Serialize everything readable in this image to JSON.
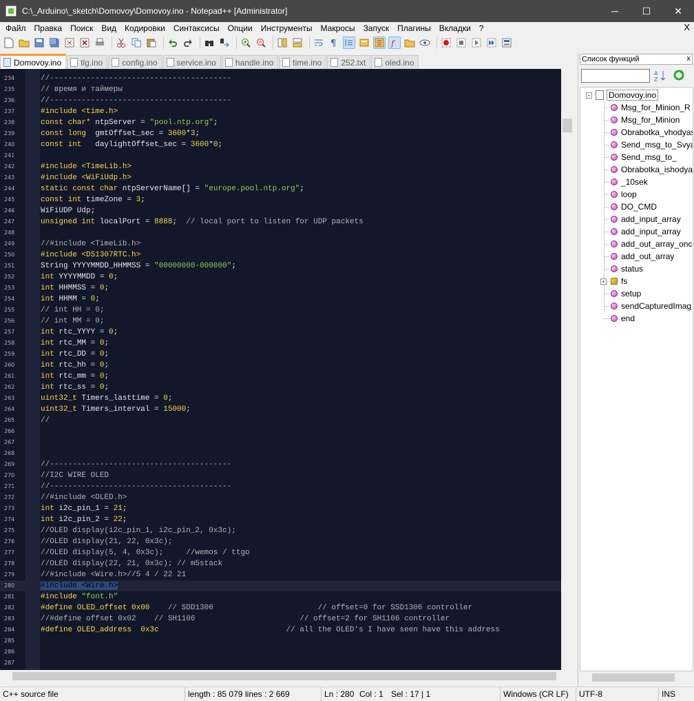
{
  "window": {
    "title": "C:\\_Arduino\\_sketch\\Domovoy\\Domovoy.ino - Notepad++ [Administrator]",
    "minimize": "─",
    "maximize": "☐",
    "close": "✕"
  },
  "menu": {
    "items": [
      "Файл",
      "Правка",
      "Поиск",
      "Вид",
      "Кодировки",
      "Синтаксисы",
      "Опции",
      "Инструменты",
      "Макросы",
      "Запуск",
      "Плагины",
      "Вкладки",
      "?"
    ],
    "close": "X"
  },
  "toolbar": {
    "icons": [
      "new-file",
      "open-file",
      "save",
      "save-all",
      "close-file",
      "close-all",
      "print",
      "cut",
      "copy",
      "paste",
      "undo",
      "redo",
      "find",
      "replace",
      "zoom-in",
      "zoom-out",
      "sync-vertical",
      "sync-horizontal",
      "word-wrap",
      "show-all-chars",
      "indent-guide",
      "doc-map",
      "function-list",
      "folder-workspace",
      "monitor",
      "record-macro",
      "stop-record",
      "play-macro",
      "play-multiple",
      "save-macro"
    ]
  },
  "tabs": [
    {
      "label": "Domovoy.ino",
      "active": true
    },
    {
      "label": "tlg.ino",
      "active": false
    },
    {
      "label": "config.ino",
      "active": false
    },
    {
      "label": "service.ino",
      "active": false
    },
    {
      "label": "handle.ino",
      "active": false
    },
    {
      "label": "time.ino",
      "active": false
    },
    {
      "label": "252.txt",
      "active": false
    },
    {
      "label": "oled.ino",
      "active": false
    }
  ],
  "editor": {
    "lines": [
      {
        "n": "234",
        "segs": [
          [
            "com",
            "//----------------------------------------"
          ]
        ]
      },
      {
        "n": "235",
        "segs": [
          [
            "com",
            "// время и таймеры"
          ]
        ]
      },
      {
        "n": "236",
        "segs": [
          [
            "com",
            "//----------------------------------------"
          ]
        ]
      },
      {
        "n": "237",
        "segs": [
          [
            "pp",
            "#include <time.h>"
          ]
        ]
      },
      {
        "n": "238",
        "segs": [
          [
            "kw",
            "const char*"
          ],
          [
            "txt",
            " ntpServer = "
          ],
          [
            "str",
            "\"pool.ntp.org\""
          ],
          [
            "txt",
            ";"
          ]
        ]
      },
      {
        "n": "239",
        "segs": [
          [
            "kw",
            "const long"
          ],
          [
            "txt",
            "  gmtOffset_sec = "
          ],
          [
            "num",
            "3600"
          ],
          [
            "txt",
            "*"
          ],
          [
            "num",
            "3"
          ],
          [
            "txt",
            ";"
          ]
        ]
      },
      {
        "n": "240",
        "segs": [
          [
            "kw",
            "const int"
          ],
          [
            "txt",
            "   daylightOffset_sec = "
          ],
          [
            "num",
            "3600"
          ],
          [
            "txt",
            "*"
          ],
          [
            "num",
            "0"
          ],
          [
            "txt",
            ";"
          ]
        ]
      },
      {
        "n": "241",
        "segs": []
      },
      {
        "n": "242",
        "segs": [
          [
            "pp",
            "#include <TimeLib.h>"
          ]
        ]
      },
      {
        "n": "243",
        "segs": [
          [
            "pp",
            "#include <WiFiUdp.h>"
          ]
        ]
      },
      {
        "n": "244",
        "segs": [
          [
            "kw",
            "static const char"
          ],
          [
            "txt",
            " ntpServerName[] = "
          ],
          [
            "str",
            "\"europe.pool.ntp.org\""
          ],
          [
            "txt",
            ";"
          ]
        ]
      },
      {
        "n": "245",
        "segs": [
          [
            "kw",
            "const int"
          ],
          [
            "txt",
            " timeZone = "
          ],
          [
            "num",
            "3"
          ],
          [
            "txt",
            ";"
          ]
        ]
      },
      {
        "n": "246",
        "segs": [
          [
            "txt",
            "WiFiUDP Udp;"
          ]
        ]
      },
      {
        "n": "247",
        "segs": [
          [
            "kw",
            "unsigned int"
          ],
          [
            "txt",
            " localPort = "
          ],
          [
            "num",
            "8888"
          ],
          [
            "txt",
            ";  "
          ],
          [
            "com",
            "// local port to listen for UDP packets"
          ]
        ]
      },
      {
        "n": "248",
        "segs": []
      },
      {
        "n": "249",
        "segs": [
          [
            "com",
            "//#include <TimeLib.h>"
          ]
        ]
      },
      {
        "n": "250",
        "segs": [
          [
            "pp",
            "#include <DS1307RTC.h>"
          ]
        ]
      },
      {
        "n": "251",
        "segs": [
          [
            "txt",
            "String YYYYMMDD_HHMMSS = "
          ],
          [
            "str",
            "\"00000000-000000\""
          ],
          [
            "txt",
            ";"
          ]
        ]
      },
      {
        "n": "252",
        "segs": [
          [
            "kw",
            "int"
          ],
          [
            "txt",
            " YYYYMMDD = "
          ],
          [
            "num",
            "0"
          ],
          [
            "txt",
            ";"
          ]
        ]
      },
      {
        "n": "253",
        "segs": [
          [
            "kw",
            "int"
          ],
          [
            "txt",
            " HHMMSS = "
          ],
          [
            "num",
            "0"
          ],
          [
            "txt",
            ";"
          ]
        ]
      },
      {
        "n": "254",
        "segs": [
          [
            "kw",
            "int"
          ],
          [
            "txt",
            " HHMM = "
          ],
          [
            "num",
            "0"
          ],
          [
            "txt",
            ";"
          ]
        ]
      },
      {
        "n": "255",
        "segs": [
          [
            "com",
            "// int HH = 0;"
          ]
        ]
      },
      {
        "n": "256",
        "segs": [
          [
            "com",
            "// int MM = 0;"
          ]
        ]
      },
      {
        "n": "257",
        "segs": [
          [
            "kw",
            "int"
          ],
          [
            "txt",
            " rtc_YYYY = "
          ],
          [
            "num",
            "0"
          ],
          [
            "txt",
            ";"
          ]
        ]
      },
      {
        "n": "258",
        "segs": [
          [
            "kw",
            "int"
          ],
          [
            "txt",
            " rtc_MM = "
          ],
          [
            "num",
            "0"
          ],
          [
            "txt",
            ";"
          ]
        ]
      },
      {
        "n": "259",
        "segs": [
          [
            "kw",
            "int"
          ],
          [
            "txt",
            " rtc_DD = "
          ],
          [
            "num",
            "0"
          ],
          [
            "txt",
            ";"
          ]
        ]
      },
      {
        "n": "260",
        "segs": [
          [
            "kw",
            "int"
          ],
          [
            "txt",
            " rtc_hh = "
          ],
          [
            "num",
            "0"
          ],
          [
            "txt",
            ";"
          ]
        ]
      },
      {
        "n": "261",
        "segs": [
          [
            "kw",
            "int"
          ],
          [
            "txt",
            " rtc_mm = "
          ],
          [
            "num",
            "0"
          ],
          [
            "txt",
            ";"
          ]
        ]
      },
      {
        "n": "262",
        "segs": [
          [
            "kw",
            "int"
          ],
          [
            "txt",
            " rtc_ss = "
          ],
          [
            "num",
            "0"
          ],
          [
            "txt",
            ";"
          ]
        ]
      },
      {
        "n": "263",
        "segs": [
          [
            "kw",
            "uint32_t"
          ],
          [
            "txt",
            " Timers_lasttime = "
          ],
          [
            "num",
            "0"
          ],
          [
            "txt",
            ";"
          ]
        ]
      },
      {
        "n": "264",
        "segs": [
          [
            "kw",
            "uint32_t"
          ],
          [
            "txt",
            " Timers_interval = "
          ],
          [
            "num",
            "15000"
          ],
          [
            "txt",
            ";"
          ]
        ]
      },
      {
        "n": "265",
        "segs": [
          [
            "com",
            "//"
          ]
        ]
      },
      {
        "n": "266",
        "segs": []
      },
      {
        "n": "267",
        "segs": []
      },
      {
        "n": "268",
        "segs": []
      },
      {
        "n": "269",
        "segs": [
          [
            "com",
            "//----------------------------------------"
          ]
        ]
      },
      {
        "n": "270",
        "segs": [
          [
            "com",
            "//I2C WIRE OLED"
          ]
        ]
      },
      {
        "n": "271",
        "segs": [
          [
            "com",
            "//----------------------------------------"
          ]
        ]
      },
      {
        "n": "272",
        "segs": [
          [
            "com",
            "//#include <OLED.h>"
          ]
        ]
      },
      {
        "n": "273",
        "segs": [
          [
            "kw",
            "int"
          ],
          [
            "txt",
            " i2c_pin_1 = "
          ],
          [
            "num",
            "21"
          ],
          [
            "txt",
            ";"
          ]
        ]
      },
      {
        "n": "274",
        "segs": [
          [
            "kw",
            "int"
          ],
          [
            "txt",
            " i2c_pin_2 = "
          ],
          [
            "num",
            "22"
          ],
          [
            "txt",
            ";"
          ]
        ]
      },
      {
        "n": "275",
        "segs": [
          [
            "com",
            "//OLED display(i2c_pin_1, i2c_pin_2, 0x3c);"
          ]
        ]
      },
      {
        "n": "276",
        "segs": [
          [
            "com",
            "//OLED display(21, 22, 0x3c);"
          ]
        ]
      },
      {
        "n": "277",
        "segs": [
          [
            "com",
            "//OLED display(5, 4, 0x3c);     //wemos / ttgo"
          ]
        ]
      },
      {
        "n": "278",
        "segs": [
          [
            "com",
            "//OLED display(22, 21, 0x3c); // m5stack"
          ]
        ]
      },
      {
        "n": "279",
        "segs": [
          [
            "com",
            "//#include <Wire.h>//5 4 / 22 21"
          ]
        ]
      },
      {
        "n": "280",
        "hl": true,
        "segs": [
          [
            "sel",
            "#include <Wire.h>"
          ]
        ]
      },
      {
        "n": "281",
        "segs": [
          [
            "pp",
            "#include "
          ],
          [
            "str",
            "\"font.h\""
          ]
        ]
      },
      {
        "n": "282",
        "segs": [
          [
            "pp",
            "#define OLED_offset 0x00"
          ],
          [
            "txt",
            "    "
          ],
          [
            "com",
            "// SDD1306                       // offset=0 for SSD1306 controller"
          ]
        ]
      },
      {
        "n": "283",
        "segs": [
          [
            "com",
            "//#define offset 0x02    // SH1106                       // offset=2 for SH1106 controller"
          ]
        ]
      },
      {
        "n": "284",
        "segs": [
          [
            "pp",
            "#define OLED_address  0x3c"
          ],
          [
            "txt",
            "                            "
          ],
          [
            "com",
            "// all the OLED's I have seen have this address"
          ]
        ]
      },
      {
        "n": "285",
        "segs": []
      },
      {
        "n": "286",
        "segs": []
      },
      {
        "n": "287",
        "segs": []
      }
    ]
  },
  "panel": {
    "title": "Список функций",
    "close": "x",
    "search_value": "",
    "root": "Domovoy.ino",
    "functions": [
      {
        "name": "Msg_for_Minion_R",
        "icon": "function"
      },
      {
        "name": "Msg_for_Minion",
        "icon": "function"
      },
      {
        "name": "Obrabotka_vhodyas",
        "icon": "function"
      },
      {
        "name": "Send_msg_to_Svyaz",
        "icon": "function"
      },
      {
        "name": "Send_msg_to_",
        "icon": "function"
      },
      {
        "name": "Obrabotka_ishodya",
        "icon": "function"
      },
      {
        "name": "_10sek",
        "icon": "function"
      },
      {
        "name": "loop",
        "icon": "function"
      },
      {
        "name": "DO_CMD",
        "icon": "function"
      },
      {
        "name": "add_input_array",
        "icon": "function"
      },
      {
        "name": "add_input_array",
        "icon": "function"
      },
      {
        "name": "add_out_array_once",
        "icon": "function"
      },
      {
        "name": "add_out_array",
        "icon": "function"
      },
      {
        "name": "status",
        "icon": "function"
      },
      {
        "name": "fs",
        "icon": "class",
        "expandable": true
      },
      {
        "name": "setup",
        "icon": "function"
      },
      {
        "name": "sendCapturedImag",
        "icon": "function"
      },
      {
        "name": "end",
        "icon": "function"
      }
    ]
  },
  "status": {
    "filetype": "C++ source file",
    "length": "length : 85 079",
    "lines": "lines : 2 669",
    "ln": "Ln : 280",
    "col": "Col : 1",
    "sel": "Sel : 17 | 1",
    "eol": "Windows (CR LF)",
    "encoding": "UTF-8",
    "mode": "INS"
  }
}
